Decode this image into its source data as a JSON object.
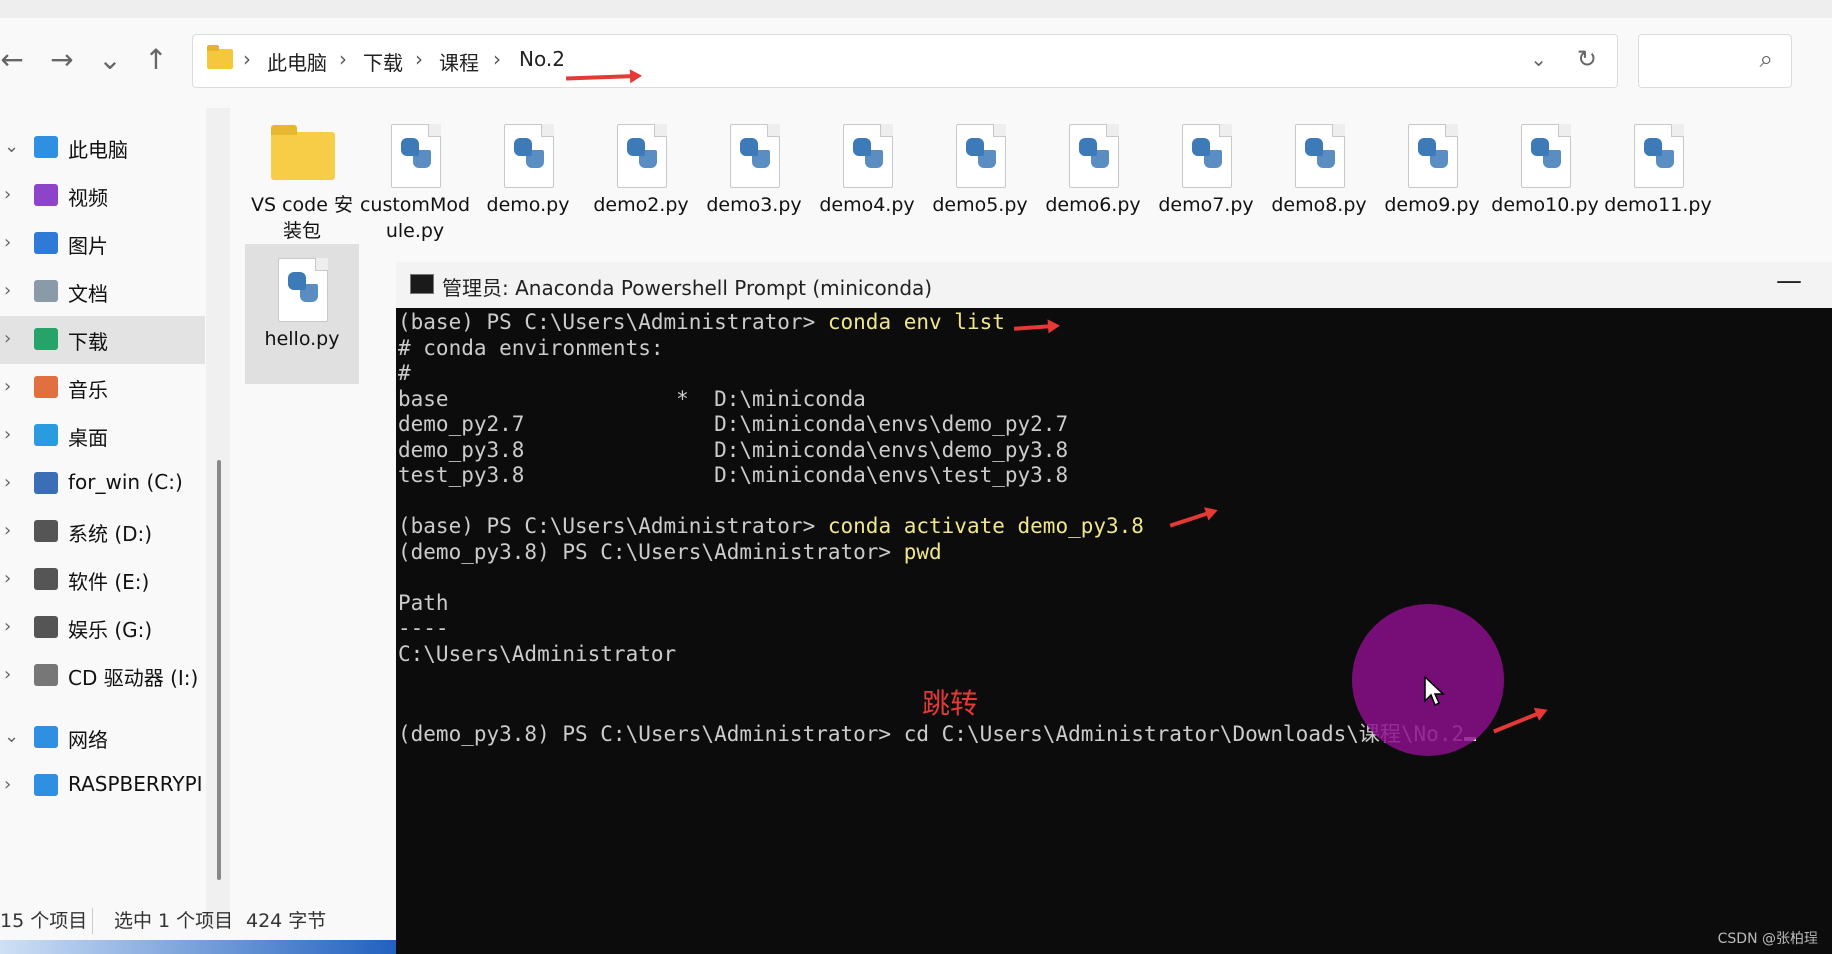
{
  "explorer": {
    "nav_buttons": {
      "back": "←",
      "forward": "→",
      "recent": "⌄",
      "up": "↑"
    },
    "breadcrumb": [
      "此电脑",
      "下载",
      "课程",
      "No.2"
    ],
    "address_dropdown": "⌄",
    "refresh": "↻",
    "search_icon": "⌕",
    "sidebar": [
      {
        "label": "此电脑",
        "icon": "computer-icon",
        "color": "#2f8fe0",
        "expanded": true
      },
      {
        "label": "视频",
        "icon": "video-icon",
        "color": "#8e44c8"
      },
      {
        "label": "图片",
        "icon": "pictures-icon",
        "color": "#2e7ad6"
      },
      {
        "label": "文档",
        "icon": "documents-icon",
        "color": "#8a9aa8"
      },
      {
        "label": "下载",
        "icon": "downloads-icon",
        "color": "#27a36a",
        "selected": true
      },
      {
        "label": "音乐",
        "icon": "music-icon",
        "color": "#e07040"
      },
      {
        "label": "桌面",
        "icon": "desktop-icon",
        "color": "#2b9be0"
      },
      {
        "label": "for_win (C:)",
        "icon": "windows-drive-icon",
        "color": "#3b6fb5"
      },
      {
        "label": "系统 (D:)",
        "icon": "drive-icon",
        "color": "#555555"
      },
      {
        "label": "软件 (E:)",
        "icon": "drive-icon",
        "color": "#555555"
      },
      {
        "label": "娱乐 (G:)",
        "icon": "drive-icon",
        "color": "#555555"
      },
      {
        "label": "CD 驱动器 (I:)",
        "icon": "cd-drive-icon",
        "color": "#777777"
      },
      {
        "label": "网络",
        "icon": "network-icon",
        "color": "#2f8fe0",
        "expanded": true
      },
      {
        "label": "RASPBERRYPI",
        "icon": "computer-icon",
        "color": "#2f8fe0"
      }
    ],
    "files": [
      {
        "name": "VS code 安装包",
        "type": "folder"
      },
      {
        "name": "customModule.py",
        "type": "python"
      },
      {
        "name": "demo.py",
        "type": "python"
      },
      {
        "name": "demo2.py",
        "type": "python"
      },
      {
        "name": "demo3.py",
        "type": "python"
      },
      {
        "name": "demo4.py",
        "type": "python"
      },
      {
        "name": "demo5.py",
        "type": "python"
      },
      {
        "name": "demo6.py",
        "type": "python"
      },
      {
        "name": "demo7.py",
        "type": "python"
      },
      {
        "name": "demo8.py",
        "type": "python"
      },
      {
        "name": "demo9.py",
        "type": "python"
      },
      {
        "name": "demo10.py",
        "type": "python"
      },
      {
        "name": "demo11.py",
        "type": "python"
      },
      {
        "name": "hello.py",
        "type": "python",
        "selected": true
      }
    ],
    "status": {
      "count": "15 个项目",
      "selection": "选中 1 个项目",
      "size": "424 字节"
    }
  },
  "terminal": {
    "title": "管理员: Anaconda Powershell Prompt (miniconda)",
    "minimize": "—",
    "lines": [
      {
        "prompt": "(base) PS C:\\Users\\Administrator> ",
        "cmd": "conda env list"
      },
      {
        "text": "# conda environments:"
      },
      {
        "text": "#"
      },
      {
        "text": "base                  *  D:\\miniconda"
      },
      {
        "text": "demo_py2.7               D:\\miniconda\\envs\\demo_py2.7"
      },
      {
        "text": "demo_py3.8               D:\\miniconda\\envs\\demo_py3.8"
      },
      {
        "text": "test_py3.8               D:\\miniconda\\envs\\test_py3.8"
      },
      {
        "text": ""
      },
      {
        "prompt": "(base) PS C:\\Users\\Administrator> ",
        "cmd": "conda activate demo_py3.8"
      },
      {
        "prompt": "(demo_py3.8) PS C:\\Users\\Administrator> ",
        "cmd": "pwd"
      },
      {
        "text": ""
      },
      {
        "text": "Path"
      },
      {
        "text": "----"
      },
      {
        "text": "C:\\Users\\Administrator"
      },
      {
        "text": ""
      },
      {
        "text": ""
      },
      {
        "prompt": "(demo_py3.8) PS C:\\Users\\Administrator> ",
        "cmd": "cd C:\\Users\\Administrator\\Downloads\\课程\\No.2"
      }
    ],
    "annotation": "跳转"
  },
  "watermark": "CSDN @张柏珵",
  "colors": {
    "accent_red": "#e53935",
    "terminal_bg": "#0c0c0c",
    "command_yellow": "#f0e68c",
    "highlight_purple": "#8b0f8b"
  }
}
